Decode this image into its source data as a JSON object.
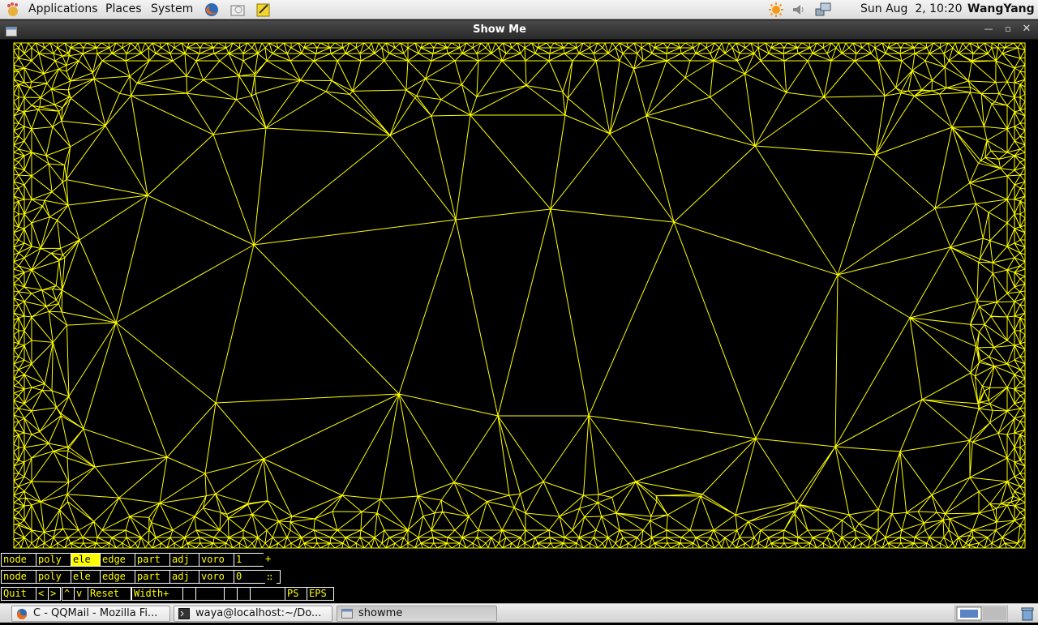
{
  "top_panel": {
    "menus": [
      "Applications",
      "Places",
      "System"
    ],
    "clock": "Sun Aug  2, 10:20",
    "user": "WangYang"
  },
  "window": {
    "title": "Show Me"
  },
  "controls": {
    "row1": [
      "node",
      "poly",
      "ele",
      "edge",
      "part",
      "adj",
      "voro",
      "1",
      "+"
    ],
    "row2": [
      "node",
      "poly",
      "ele",
      "edge",
      "part",
      "adj",
      "voro",
      "0",
      "∷"
    ],
    "row3": [
      "Quit",
      "<",
      ">",
      "^",
      "v",
      "Reset",
      "Width+",
      "",
      "",
      "",
      "",
      "",
      "PS",
      "EPS"
    ],
    "active": "ele"
  },
  "taskbar": {
    "tasks": [
      "C - QQMail - Mozilla Fi...",
      "waya@localhost:~/Do...",
      "showme"
    ]
  },
  "colors": {
    "mesh": "#ffff00",
    "canvas": "#000000"
  },
  "icons": [
    "foot-icon",
    "firefox-icon",
    "mail-icon",
    "notes-icon",
    "weather-icon",
    "volume-icon",
    "network-icon",
    "terminal-icon",
    "window-icon",
    "show-desktop-icon",
    "trash-icon"
  ]
}
